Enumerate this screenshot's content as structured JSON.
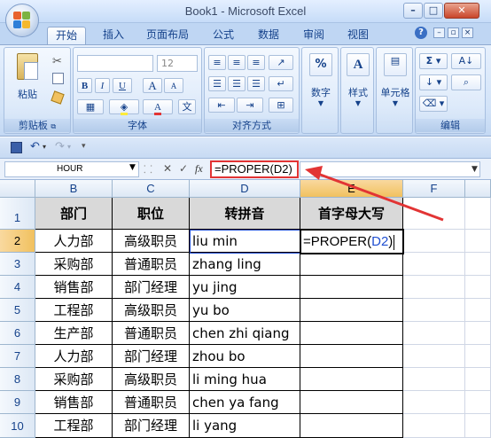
{
  "window": {
    "title": "Book1 - Microsoft Excel"
  },
  "tabs": [
    "开始",
    "插入",
    "页面布局",
    "公式",
    "数据",
    "审阅",
    "视图"
  ],
  "active_tab": "开始",
  "ribbon": {
    "clipboard": {
      "paste_label": "粘贴",
      "group_label": "剪贴板"
    },
    "font": {
      "size_value": "12",
      "bold": "B",
      "italic": "I",
      "underline": "U",
      "grow": "A",
      "shrink": "A",
      "font_color": "A",
      "group_label": "字体"
    },
    "alignment": {
      "group_label": "对齐方式"
    },
    "number": {
      "label": "数字",
      "icon_text": "%"
    },
    "styles": {
      "label": "样式",
      "icon_text": "A"
    },
    "cells": {
      "label": "单元格"
    },
    "editing": {
      "group_label": "编辑",
      "sigma": "Σ"
    }
  },
  "formula_bar": {
    "name_box": "HOUR",
    "fx": "fx",
    "cancel": "✕",
    "enter": "✓",
    "formula": "=PROPER(D2)"
  },
  "columns": [
    "B",
    "C",
    "D",
    "E",
    "F"
  ],
  "selected_column": "E",
  "rows": [
    "1",
    "2",
    "3",
    "4",
    "5",
    "6",
    "7",
    "8",
    "9",
    "10"
  ],
  "selected_row": "2",
  "table": {
    "headers": [
      "部门",
      "职位",
      "转拼音",
      "首字母大写"
    ],
    "data": [
      [
        "人力部",
        "高级职员",
        "liu min"
      ],
      [
        "采购部",
        "普通职员",
        "zhang ling"
      ],
      [
        "销售部",
        "部门经理",
        "yu jing"
      ],
      [
        "工程部",
        "高级职员",
        "yu bo"
      ],
      [
        "生产部",
        "普通职员",
        "chen zhi qiang"
      ],
      [
        "人力部",
        "部门经理",
        "zhou bo"
      ],
      [
        "采购部",
        "高级职员",
        "li ming hua"
      ],
      [
        "销售部",
        "普通职员",
        "chen ya fang"
      ],
      [
        "工程部",
        "部门经理",
        "li yang"
      ]
    ],
    "editing_cell": {
      "prefix": "=PROPER(",
      "ref": "D2",
      "suffix": ")"
    }
  },
  "colors": {
    "annotation": "#e23434",
    "header_fill": "#d9d9d9",
    "ref_highlight": "#1f4fd1"
  }
}
